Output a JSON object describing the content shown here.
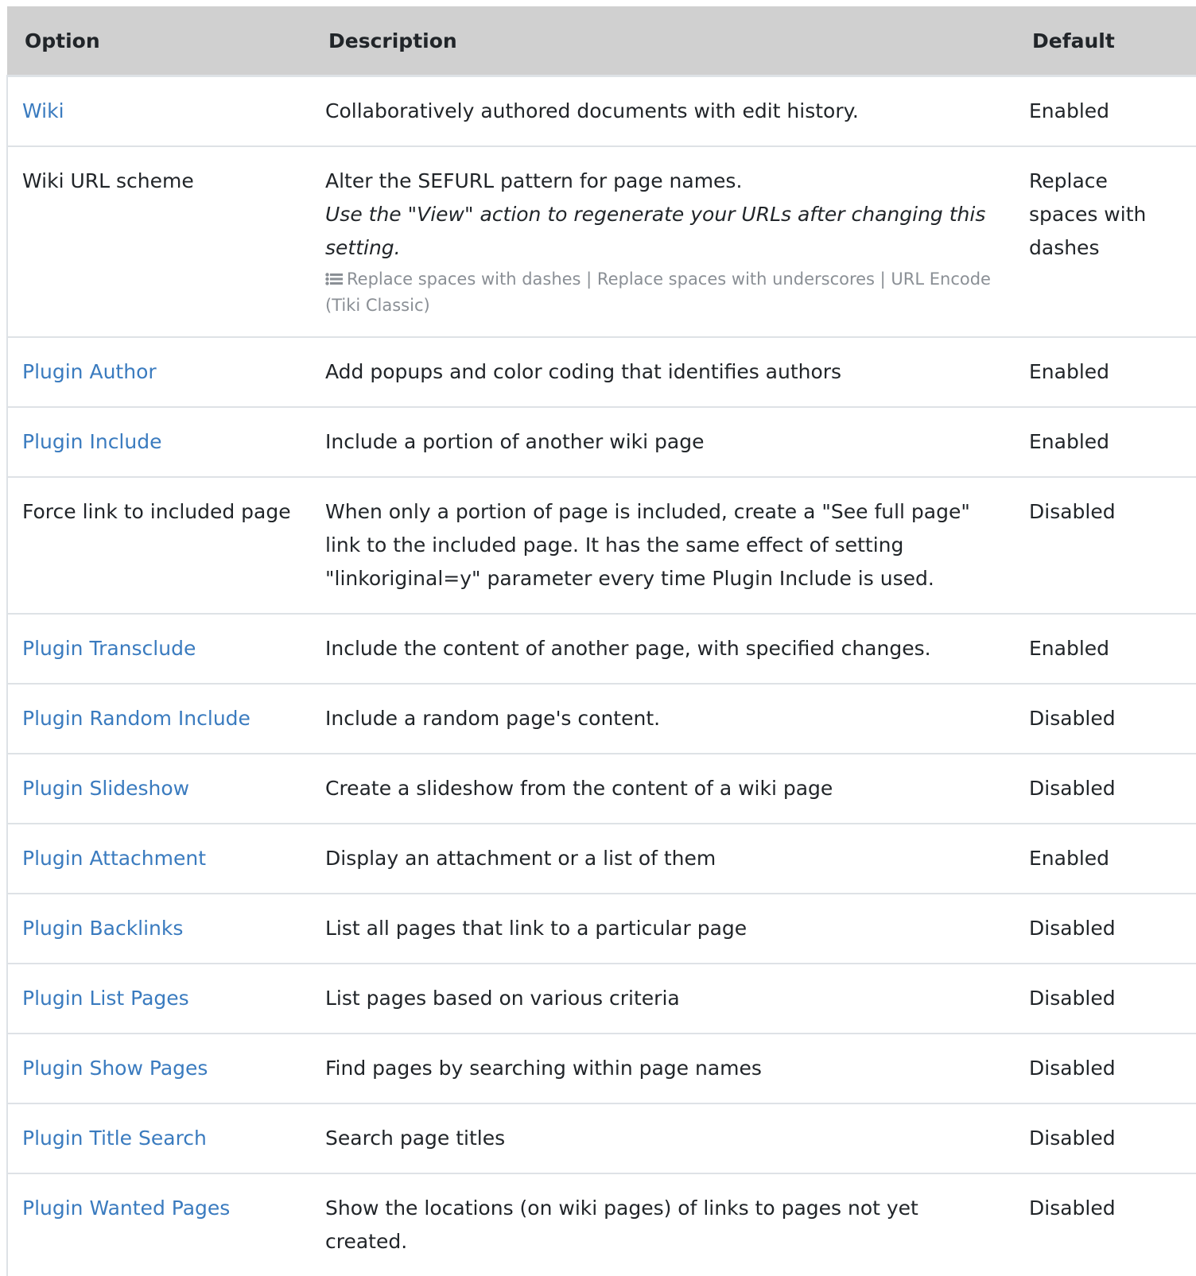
{
  "colors": {
    "link": "#3a7bbf",
    "header_bg": "#d0d0d0",
    "border": "#dee2e6",
    "muted": "#8a8f95"
  },
  "table": {
    "headers": {
      "option": "Option",
      "description": "Description",
      "default": "Default"
    },
    "rows": [
      {
        "option": "Wiki",
        "is_link": true,
        "description": "Collaboratively authored documents with edit history.",
        "default": "Enabled"
      },
      {
        "option": "Wiki URL scheme",
        "is_link": false,
        "description": "Alter the SEFURL pattern for page names.",
        "note": "Use the \"View\" action to regenerate your URLs after changing this setting.",
        "choices": "Replace spaces with dashes | Replace spaces with underscores | URL Encode (Tiki Classic)",
        "choices_icon": "list-icon",
        "default": "Replace spaces with dashes"
      },
      {
        "option": "Plugin Author",
        "is_link": true,
        "description": "Add popups and color coding that identifies authors",
        "default": "Enabled"
      },
      {
        "option": "Plugin Include",
        "is_link": true,
        "description": "Include a portion of another wiki page",
        "default": "Enabled"
      },
      {
        "option": "Force link to included page",
        "is_link": false,
        "description": "When only a portion of page is included, create a \"See full page\" link to the included page. It has the same effect of setting \"linkoriginal=y\" parameter every time Plugin Include is used.",
        "default": "Disabled"
      },
      {
        "option": "Plugin Transclude",
        "is_link": true,
        "description": "Include the content of another page, with specified changes.",
        "default": "Enabled"
      },
      {
        "option": "Plugin Random Include",
        "is_link": true,
        "description": "Include a random page's content.",
        "default": "Disabled"
      },
      {
        "option": "Plugin Slideshow",
        "is_link": true,
        "description": "Create a slideshow from the content of a wiki page",
        "default": "Disabled"
      },
      {
        "option": "Plugin Attachment",
        "is_link": true,
        "description": "Display an attachment or a list of them",
        "default": "Enabled"
      },
      {
        "option": "Plugin Backlinks",
        "is_link": true,
        "description": "List all pages that link to a particular page",
        "default": "Disabled"
      },
      {
        "option": "Plugin List Pages",
        "is_link": true,
        "description": "List pages based on various criteria",
        "default": "Disabled"
      },
      {
        "option": "Plugin Show Pages",
        "is_link": true,
        "description": "Find pages by searching within page names",
        "default": "Disabled"
      },
      {
        "option": "Plugin Title Search",
        "is_link": true,
        "description": "Search page titles",
        "default": "Disabled"
      },
      {
        "option": "Plugin Wanted Pages",
        "is_link": true,
        "description": "Show the locations (on wiki pages) of links to pages not yet created.",
        "default": "Disabled"
      }
    ]
  }
}
